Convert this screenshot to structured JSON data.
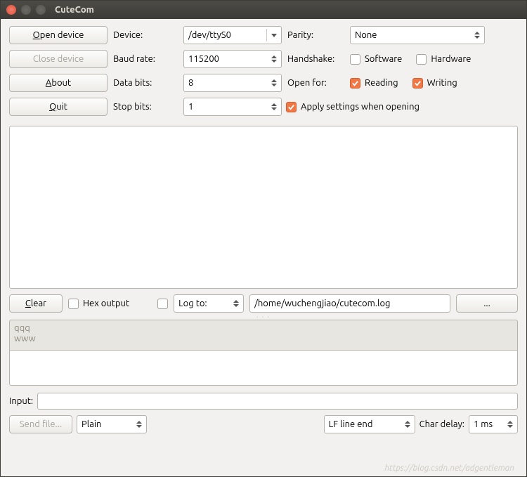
{
  "window": {
    "title": "CuteCom"
  },
  "buttons": {
    "open": "Open device",
    "close": "Close device",
    "about": "About",
    "quit": "Quit",
    "clear": "Clear",
    "browse": "...",
    "sendfile": "Send file..."
  },
  "labels": {
    "device": "Device:",
    "baud": "Baud rate:",
    "databits": "Data bits:",
    "stopbits": "Stop bits:",
    "parity": "Parity:",
    "handshake": "Handshake:",
    "openfor": "Open for:",
    "hexout": "Hex output",
    "logto": "Log to:",
    "input": "Input:",
    "chardelay": "Char delay:"
  },
  "values": {
    "device": "/dev/ttyS0",
    "baud": "115200",
    "databits": "8",
    "stopbits": "1",
    "parity": "None",
    "software": "Software",
    "hardware": "Hardware",
    "reading": "Reading",
    "writing": "Writing",
    "apply": "Apply settings when opening",
    "logpath": "/home/wuchengjiao/cutecom.log",
    "sendmode": "Plain",
    "lineend": "LF line end",
    "chardelay": "1 ms"
  },
  "checks": {
    "software": false,
    "hardware": false,
    "reading": true,
    "writing": true,
    "apply": true,
    "hexout": false,
    "logto": false
  },
  "history": [
    "qqq",
    "www"
  ],
  "watermark": "https://blog.csdn.net/adgentleman"
}
